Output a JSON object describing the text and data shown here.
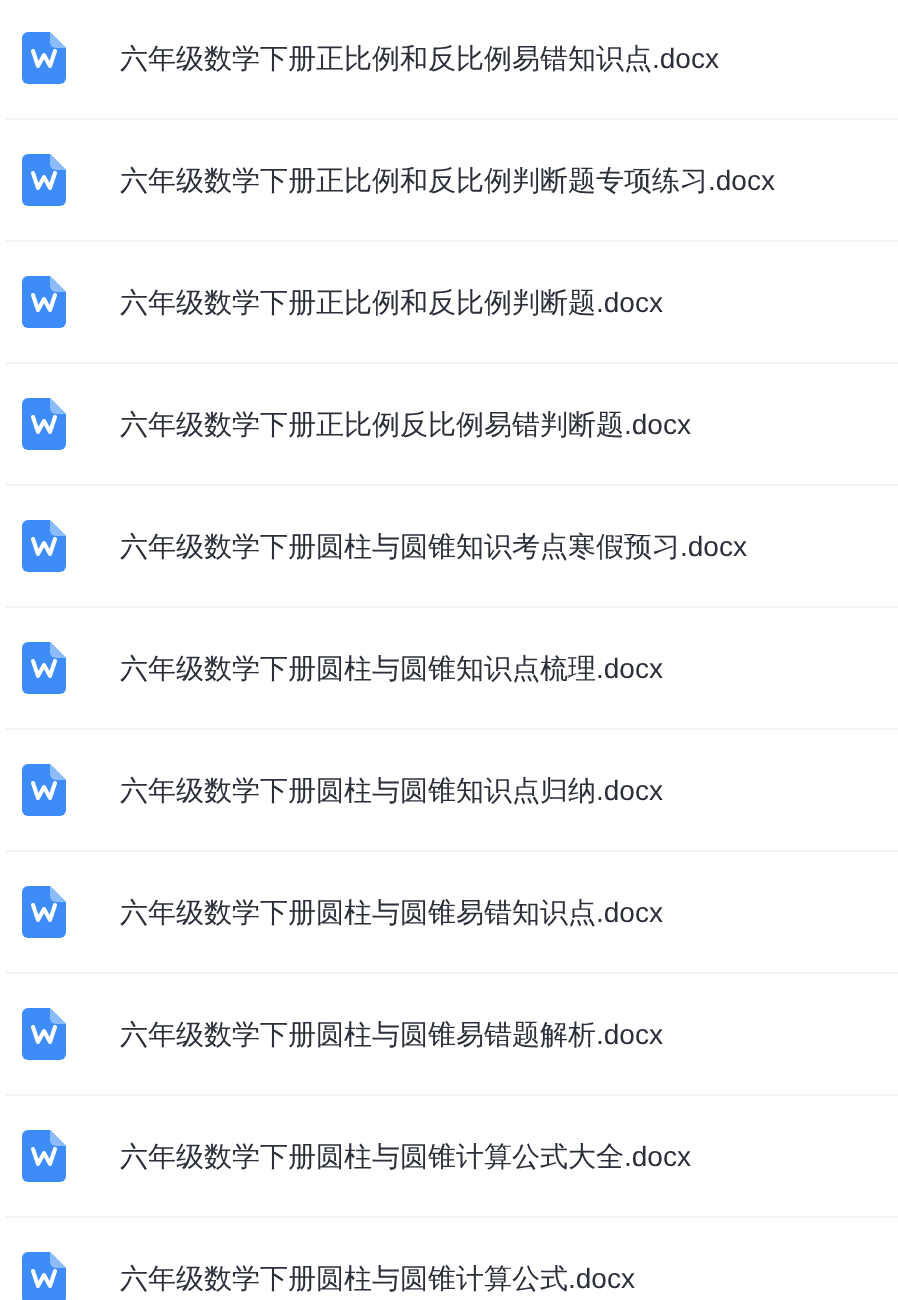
{
  "files": [
    {
      "name": "六年级数学下册正比例和反比例易错知识点.docx"
    },
    {
      "name": "六年级数学下册正比例和反比例判断题专项练习.docx"
    },
    {
      "name": "六年级数学下册正比例和反比例判断题.docx"
    },
    {
      "name": "六年级数学下册正比例反比例易错判断题.docx"
    },
    {
      "name": "六年级数学下册圆柱与圆锥知识考点寒假预习.docx"
    },
    {
      "name": "六年级数学下册圆柱与圆锥知识点梳理.docx"
    },
    {
      "name": "六年级数学下册圆柱与圆锥知识点归纳.docx"
    },
    {
      "name": "六年级数学下册圆柱与圆锥易错知识点.docx"
    },
    {
      "name": "六年级数学下册圆柱与圆锥易错题解析.docx"
    },
    {
      "name": "六年级数学下册圆柱与圆锥计算公式大全.docx"
    },
    {
      "name": "六年级数学下册圆柱与圆锥计算公式.docx"
    }
  ]
}
